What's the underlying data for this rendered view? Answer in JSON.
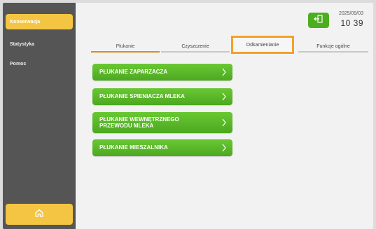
{
  "sidebar": {
    "items": [
      {
        "label": "Konserwacja",
        "active": true
      },
      {
        "label": "Statystyka",
        "active": false
      },
      {
        "label": "Pomoc",
        "active": false
      }
    ],
    "home_icon": "home-icon"
  },
  "header": {
    "logout_icon": "logout-icon",
    "date": "2025/09/03",
    "time": "10 39"
  },
  "tabs": [
    {
      "label": "Płukanie",
      "state": "active"
    },
    {
      "label": "Czyszczenie",
      "state": "normal"
    },
    {
      "label": "Odkamienianie",
      "state": "highlighted"
    },
    {
      "label": "Funkcje ogólne",
      "state": "normal"
    }
  ],
  "actions": [
    {
      "label": "PŁUKANIE ZAPARZACZA"
    },
    {
      "label": "PŁUKANIE SPIENIACZA MLEKA"
    },
    {
      "label": "PŁUKANIE WEWNĘTRZNEGO PRZEWODU MLEKA"
    },
    {
      "label": "PŁUKANIE MIESZALNIKA"
    }
  ],
  "colors": {
    "sidebar_bg": "#555555",
    "accent_yellow": "#f4c542",
    "button_green": "#4ca820",
    "highlight_orange": "#f3a12b"
  }
}
